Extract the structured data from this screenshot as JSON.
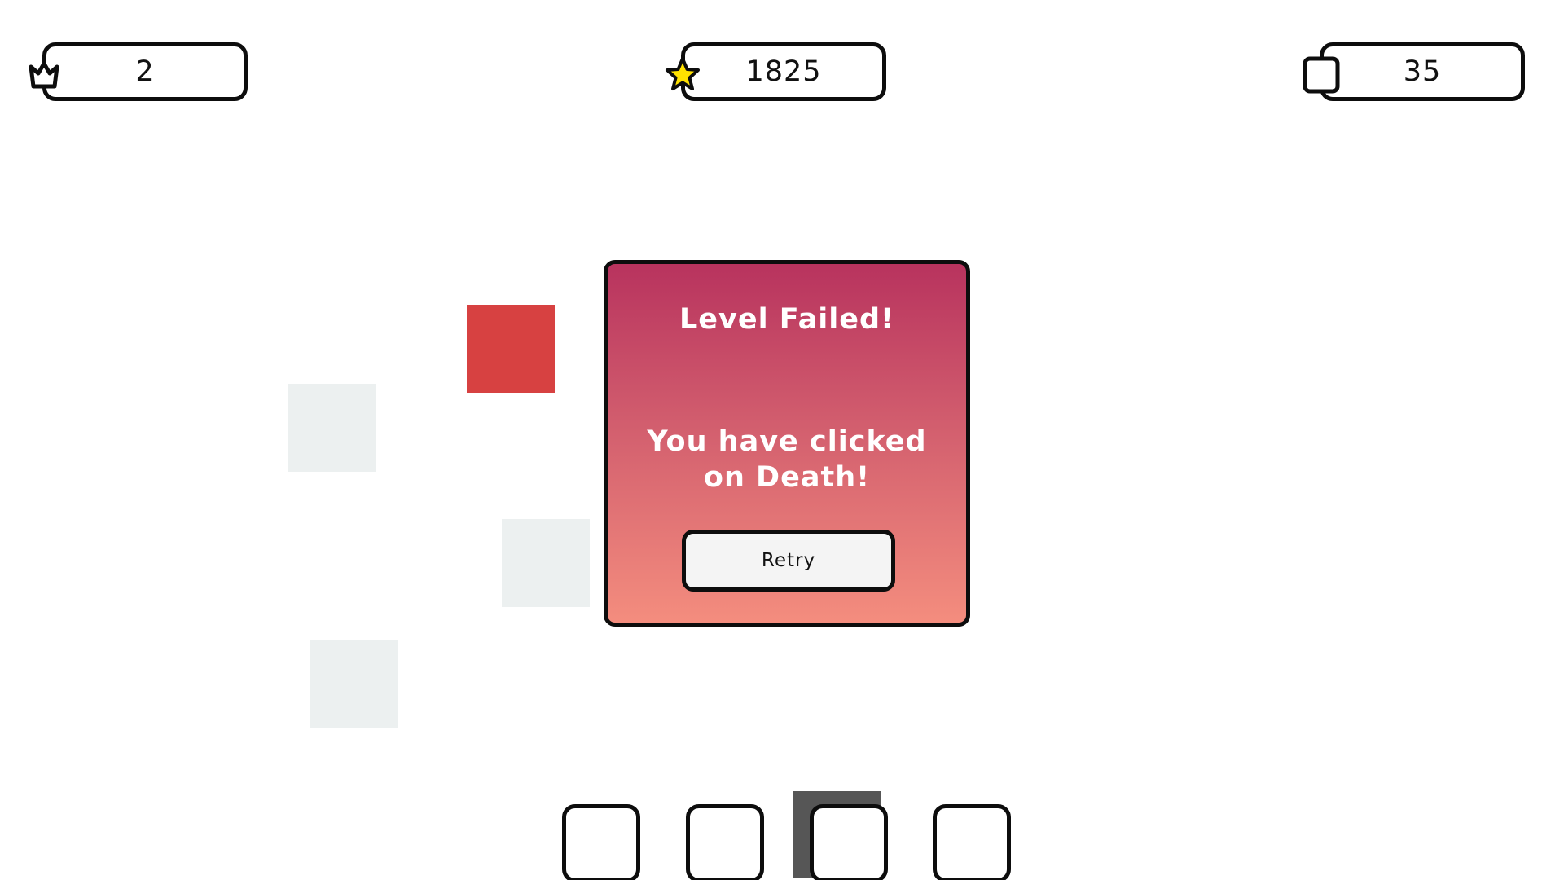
{
  "hud": {
    "lives": {
      "icon": "crown-icon",
      "value": "2"
    },
    "score": {
      "icon": "star-icon",
      "value": "1825",
      "icon_color": "#ffe100"
    },
    "remaining": {
      "icon": "square-icon",
      "value": "35"
    }
  },
  "tiles": {
    "death_color": "#d74141",
    "ghost_color": "#ecf0f0"
  },
  "dialog": {
    "title": "Level Failed!",
    "message": "You have clicked on Death!",
    "retry_label": "Retry",
    "gradient_top": "#b8335e",
    "gradient_bottom": "#f48d7e"
  },
  "slots": {
    "count": 4,
    "selected_index": 2,
    "selected_color": "#565656"
  }
}
